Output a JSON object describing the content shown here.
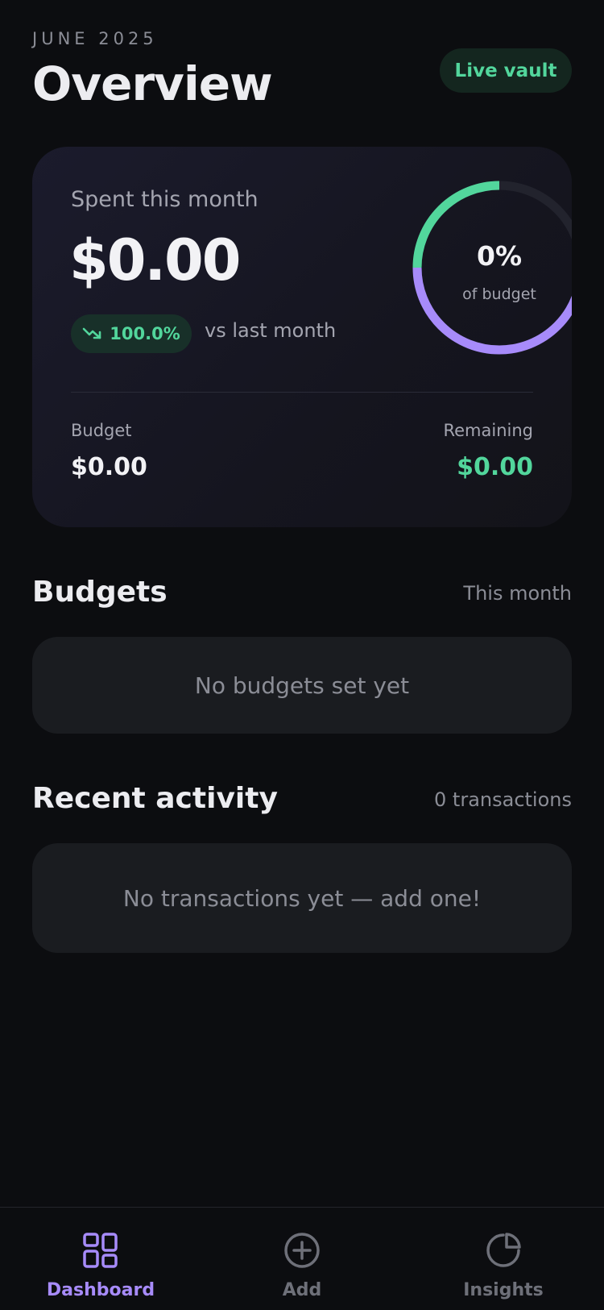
{
  "header": {
    "month": "JUNE 2025",
    "title": "Overview",
    "vault_badge": "Live vault"
  },
  "summary": {
    "spent_label": "Spent this month",
    "spent_amount": "$0.00",
    "delta_percent": "100.0%",
    "delta_direction": "trending-down",
    "delta_caption": "vs last month",
    "ring_percent": "0%",
    "ring_caption": "of budget",
    "budget_label": "Budget",
    "budget_value": "$0.00",
    "remaining_label": "Remaining",
    "remaining_value": "$0.00"
  },
  "budgets": {
    "title": "Budgets",
    "period": "This month",
    "empty_text": "No budgets set yet"
  },
  "activity": {
    "title": "Recent activity",
    "count": "0 transactions",
    "empty_text": "No transactions yet — add one!"
  },
  "nav": {
    "items": [
      {
        "label": "Dashboard",
        "icon": "grid-icon",
        "active": true
      },
      {
        "label": "Add",
        "icon": "plus-circle-icon",
        "active": false
      },
      {
        "label": "Insights",
        "icon": "pie-chart-icon",
        "active": false
      }
    ]
  },
  "colors": {
    "background": "#0c0d10",
    "accent_green": "#52d69c",
    "accent_purple": "#a78bfa",
    "muted_text": "#8b8d96"
  }
}
